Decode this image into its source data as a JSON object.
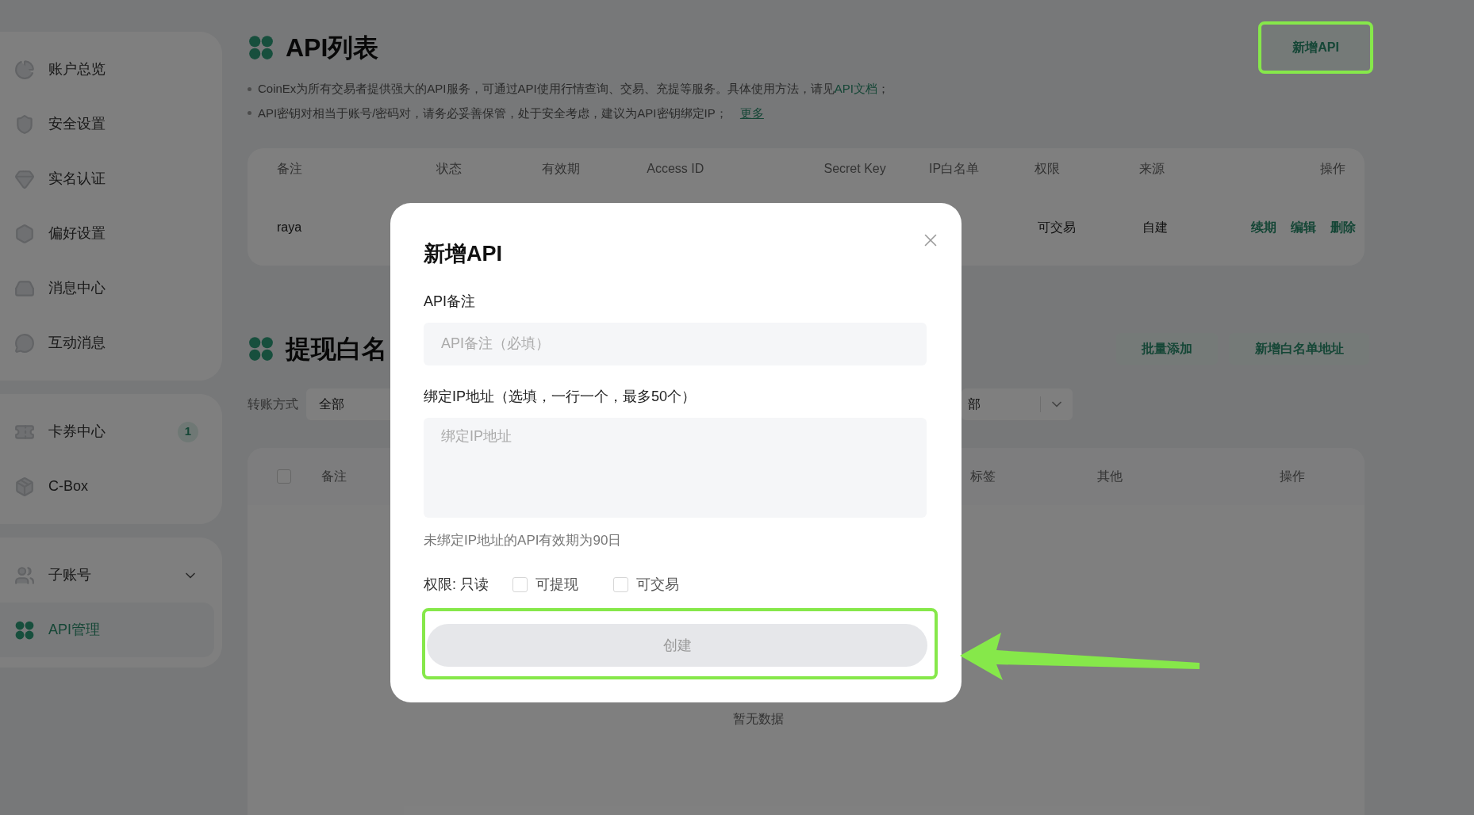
{
  "sidebar": {
    "groups": [
      {
        "items": [
          {
            "label": "账户总览",
            "kind": "link",
            "selected": false
          },
          {
            "label": "安全设置",
            "kind": "link",
            "selected": false
          },
          {
            "label": "实名认证",
            "kind": "link",
            "selected": false
          },
          {
            "label": "偏好设置",
            "kind": "link",
            "selected": false
          },
          {
            "label": "消息中心",
            "kind": "link",
            "selected": false
          },
          {
            "label": "互动消息",
            "kind": "link",
            "selected": false
          }
        ]
      },
      {
        "items": [
          {
            "label": "卡券中心",
            "kind": "link",
            "selected": false,
            "badge": "1"
          },
          {
            "label": "C-Box",
            "kind": "link",
            "selected": false
          }
        ]
      },
      {
        "items": [
          {
            "label": "子账号",
            "kind": "dropdown",
            "selected": false
          },
          {
            "label": "API管理",
            "kind": "link",
            "selected": true
          }
        ]
      }
    ]
  },
  "api_list": {
    "title": "API列表",
    "new_button": {
      "label": "新增API",
      "highlighted": true
    },
    "notes": [
      {
        "text": "CoinEx为所有交易者提供强大的API服务，可通过API使用行情查询、交易、充提等服务。具体使用方法，请见",
        "link": "API文档",
        "after": "；"
      },
      {
        "text": "API密钥对相当于账号/密码对，请务必妥善保管，处于安全考虑，建议为API密钥绑定IP；",
        "link": "更多"
      }
    ],
    "columns": [
      "备注",
      "状态",
      "有效期",
      "Access ID",
      "Secret Key",
      "IP白名单",
      "权限",
      "来源",
      "操作"
    ],
    "rows": [
      {
        "note": "raya",
        "permission": "可交易",
        "source": "自建",
        "actions": [
          "续期",
          "编辑",
          "删除"
        ]
      }
    ]
  },
  "whitelist": {
    "title": "提现白名",
    "buttons": [
      "批量添加",
      "新增白名单地址"
    ],
    "filters": [
      {
        "label": "转账方式",
        "value": "全部"
      },
      {
        "value": "部"
      }
    ],
    "select_all": {
      "checked": false
    },
    "columns": [
      "备注",
      "标签",
      "其他",
      "操作"
    ],
    "empty": "暂无数据"
  },
  "modal": {
    "title": "新增API",
    "fields": [
      {
        "kind": "input",
        "label": "API备注",
        "placeholder": "API备注（必填）"
      },
      {
        "kind": "textarea",
        "label": "绑定IP地址（选填，一行一个，最多50个）",
        "placeholder": "绑定IP地址"
      }
    ],
    "hint": "未绑定IP地址的API有效期为90日",
    "permissions": {
      "label": "权限: 只读",
      "options": [
        {
          "label": "可提现",
          "checked": false
        },
        {
          "label": "可交易",
          "checked": false
        }
      ]
    },
    "submit": {
      "label": "创建",
      "disabled": true,
      "highlighted": true,
      "arrow": true
    }
  }
}
